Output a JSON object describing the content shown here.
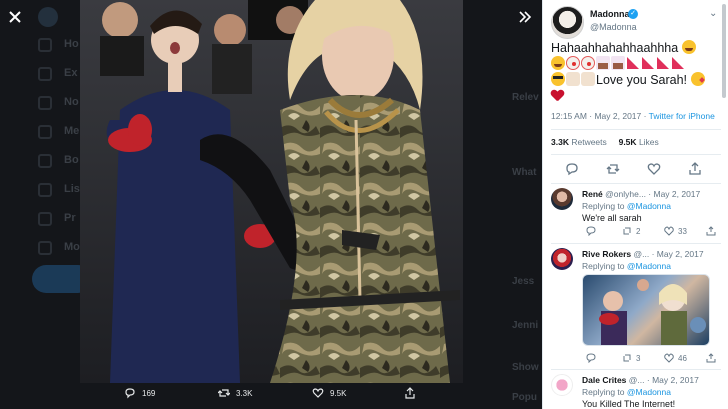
{
  "background_nav": {
    "items": [
      "Ho",
      "Ex",
      "No",
      "Me",
      "Bo",
      "Lis",
      "Pr",
      "Mo"
    ],
    "right_labels": [
      "Relev",
      "What",
      "Jess",
      "Jenni",
      "Show",
      "Popu"
    ]
  },
  "viewer": {
    "close_icon": "close-icon",
    "expand_icon": "expand-icon",
    "reply_count": "169",
    "retweet_count": "3.3K",
    "like_count": "9.5K"
  },
  "tweet": {
    "author_name": "Madonna",
    "author_handle": "@Madonna",
    "text_line1": "Hahaahhahahhaahhha",
    "text_love": "Love you Sarah!",
    "timestamp": "12:15 AM · May 2, 2017 · ",
    "source": "Twitter for iPhone",
    "retweets_value": "3.3K",
    "retweets_label": "Retweets",
    "likes_value": "9.5K",
    "likes_label": "Likes"
  },
  "replies": [
    {
      "name": "René",
      "handle_date": "@onlyhe... · May 2, 2017",
      "replying_label": "Replying to",
      "replying_handle": "@Madonna",
      "text": "We're all sarah",
      "reply_count": "",
      "retweet_count": "2",
      "like_count": "33"
    },
    {
      "name": "Rive Rokers",
      "handle_date": "@... · May 2, 2017",
      "replying_label": "Replying to",
      "replying_handle": "@Madonna",
      "text": "",
      "reply_count": "",
      "retweet_count": "3",
      "like_count": "46"
    },
    {
      "name": "Dale Crites",
      "handle_date": "@... · May 2, 2017",
      "replying_label": "Replying to",
      "replying_handle": "@Madonna",
      "text": "You Killed The Internet!"
    }
  ],
  "colors": {
    "accent": "#1da1f2",
    "link": "#1b95e0",
    "muted": "#657786",
    "text": "#14171a",
    "overlay": "#14161a"
  }
}
